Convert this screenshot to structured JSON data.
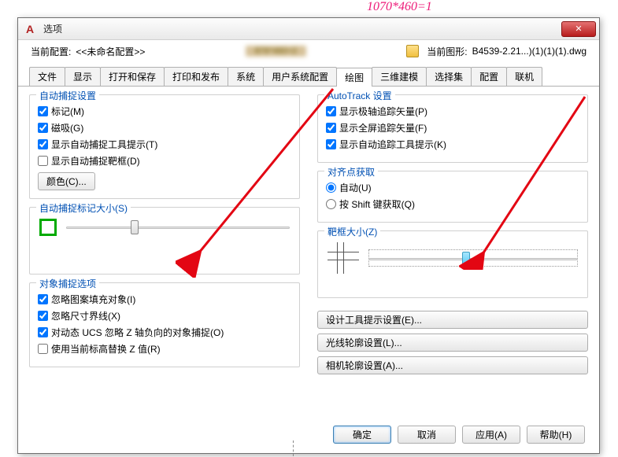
{
  "annotation_top": "1070*460=1",
  "dialog": {
    "title": "选项"
  },
  "toprow": {
    "left_label": "当前配置:",
    "left_value": "<<未命名配置>>",
    "right_label": "当前图形:",
    "right_value": "B4539-2.21...)(1)(1)(1).dwg"
  },
  "tabs": {
    "items": [
      {
        "label": "文件"
      },
      {
        "label": "显示"
      },
      {
        "label": "打开和保存"
      },
      {
        "label": "打印和发布"
      },
      {
        "label": "系统"
      },
      {
        "label": "用户系统配置"
      },
      {
        "label": "绘图",
        "active": true
      },
      {
        "label": "三维建模"
      },
      {
        "label": "选择集"
      },
      {
        "label": "配置"
      },
      {
        "label": "联机"
      }
    ]
  },
  "left_groups": {
    "auto_snap": {
      "legend": "自动捕捉设置",
      "marker": "标记(M)",
      "magnet": "磁吸(G)",
      "snap_tooltip": "显示自动捕捉工具提示(T)",
      "snap_aperture": "显示自动捕捉靶框(D)",
      "color_btn": "颜色(C)..."
    },
    "marker_size": {
      "legend": "自动捕捉标记大小(S)"
    },
    "snap_options": {
      "legend": "对象捕捉选项",
      "ignore_hatch": "忽略图案填充对象(I)",
      "ignore_dim": "忽略尺寸界线(X)",
      "dyn_ucs": "对动态 UCS 忽略 Z 轴负向的对象捕捉(O)",
      "use_elev": "使用当前标高替换 Z 值(R)"
    }
  },
  "right_groups": {
    "autotrack": {
      "legend": "AutoTrack 设置",
      "polar": "显示极轴追踪矢量(P)",
      "full": "显示全屏追踪矢量(F)",
      "tooltip": "显示自动追踪工具提示(K)"
    },
    "align": {
      "legend": "对齐点获取",
      "auto": "自动(U)",
      "shift": "按 Shift 键获取(Q)"
    },
    "aperture": {
      "legend": "靶框大小(Z)"
    },
    "buttons": {
      "design": "设计工具提示设置(E)...",
      "light": "光线轮廓设置(L)...",
      "camera": "相机轮廓设置(A)..."
    }
  },
  "bottom": {
    "ok": "确定",
    "cancel": "取消",
    "apply": "应用(A)",
    "help": "帮助(H)"
  },
  "blur": "876*460=2"
}
